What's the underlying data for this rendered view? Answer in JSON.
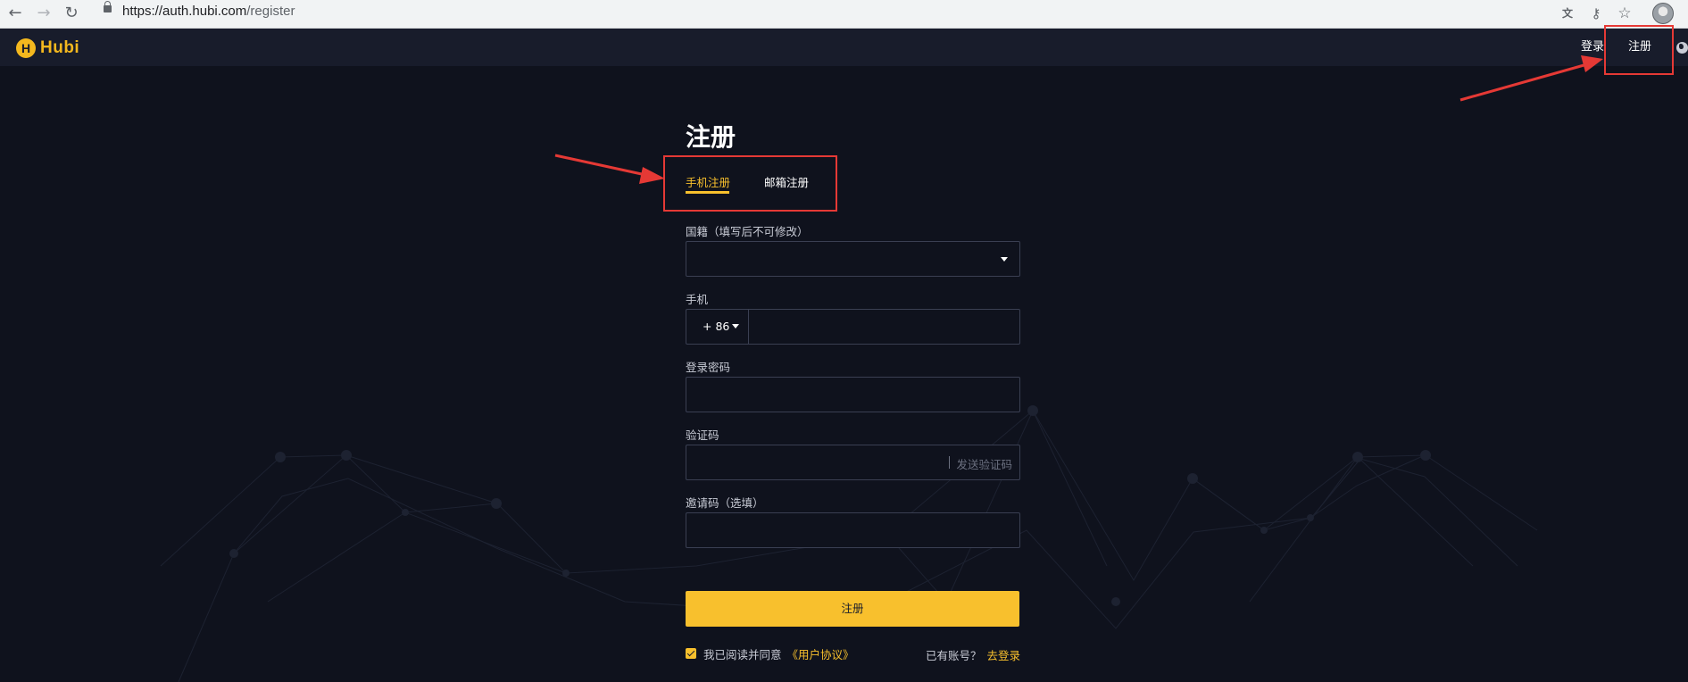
{
  "browser": {
    "url_scheme": "https://",
    "url_host": "auth.hubi.com",
    "url_path": "/register",
    "icons": [
      "back-arrow-icon",
      "forward-arrow-icon",
      "reload-icon",
      "lock-icon",
      "translate-icon",
      "key-icon",
      "star-icon",
      "profile-avatar"
    ]
  },
  "header": {
    "logo_mark": "H",
    "logo_text": "Hubi",
    "login": "登录",
    "register": "注册",
    "language_icon": "globe-icon"
  },
  "form": {
    "title": "注册",
    "tabs": [
      {
        "label": "手机注册",
        "active": true
      },
      {
        "label": "邮箱注册",
        "active": false
      }
    ],
    "nationality_label": "国籍（填写后不可修改）",
    "nationality_value": "",
    "phone_label": "手机",
    "phone_prefix": "+ 86",
    "phone_value": "",
    "password_label": "登录密码",
    "password_value": "",
    "code_label": "验证码",
    "code_value": "",
    "send_code": "发送验证码",
    "invite_label": "邀请码（选填）",
    "invite_value": "",
    "submit": "注册",
    "agree_checked": true,
    "agree_text": "我已阅读并同意",
    "agreement_link": "《用户协议》",
    "have_account": "已有账号？",
    "go_login": "去登录"
  },
  "colors": {
    "page_bg": "#0f121d",
    "header_bg": "#181c2b",
    "accent": "#f8c02d",
    "annotation": "#e53935"
  }
}
